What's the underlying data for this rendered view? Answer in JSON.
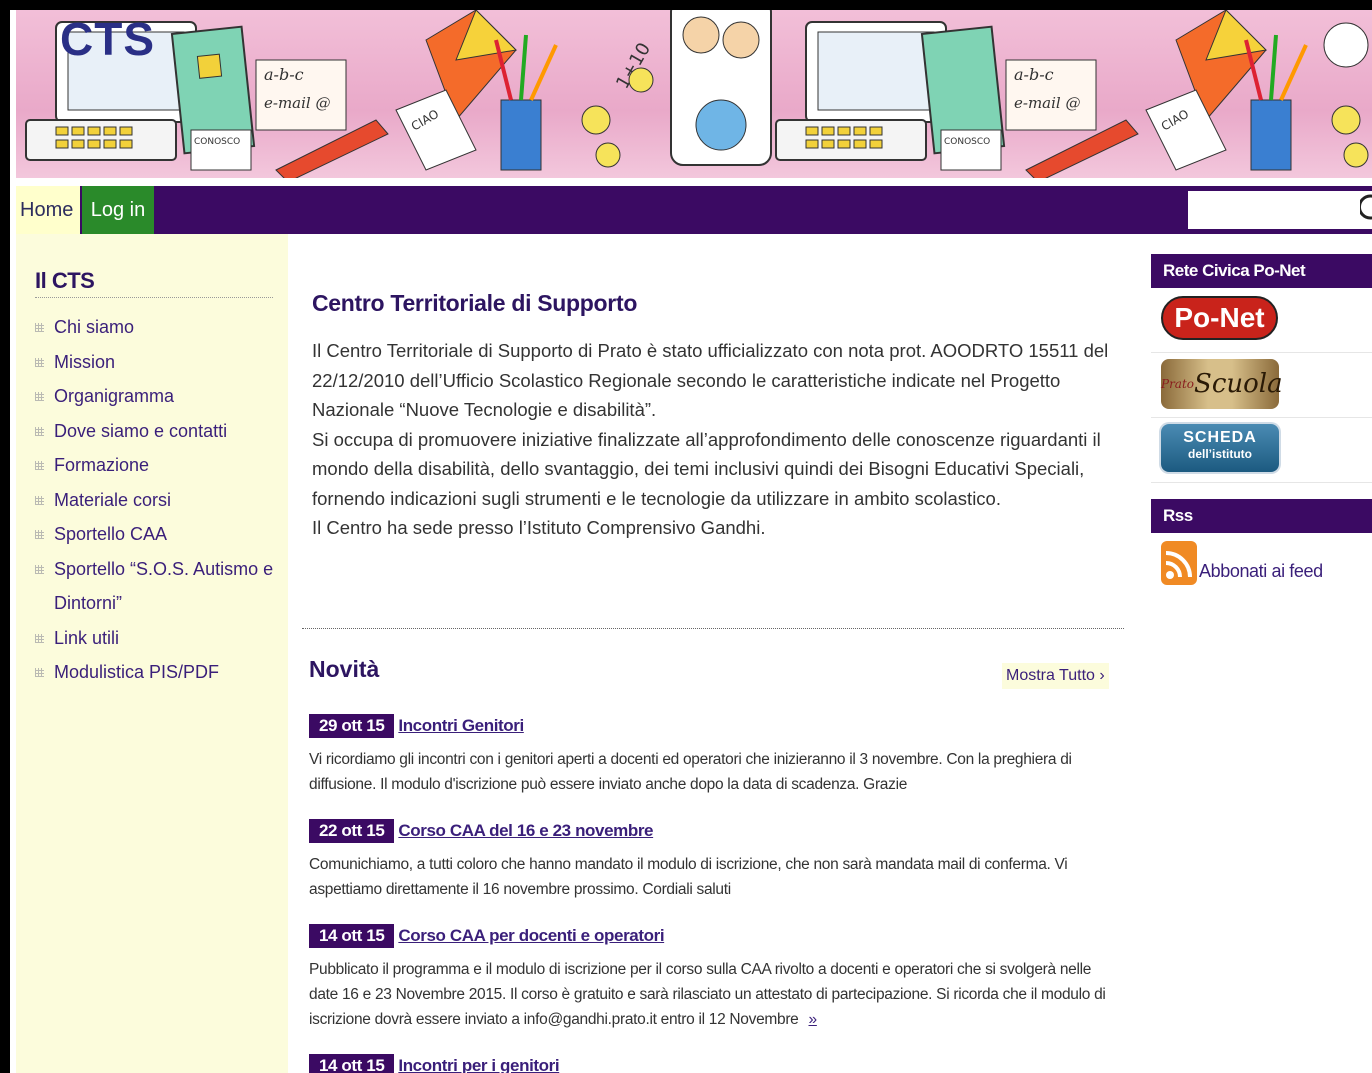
{
  "header": {
    "logo_text": "CTS",
    "banner_words": [
      "a-b-c",
      "e-mail @",
      "CONOSCO",
      "CIAO",
      "1+10"
    ]
  },
  "nav": {
    "home": "Home",
    "login": "Log in",
    "search_placeholder": "",
    "search_icon": "search-icon"
  },
  "sidebar": {
    "title": "Il CTS",
    "items": [
      {
        "label": "Chi siamo"
      },
      {
        "label": "Mission"
      },
      {
        "label": "Organigramma"
      },
      {
        "label": "Dove siamo e contatti"
      },
      {
        "label": "Formazione"
      },
      {
        "label": "Materiale corsi"
      },
      {
        "label": "Sportello CAA"
      },
      {
        "label": "Sportello “S.O.S. Autismo e Dintorni”"
      },
      {
        "label": "Link utili"
      },
      {
        "label": "Modulistica PIS/PDF"
      }
    ]
  },
  "main": {
    "title": "Centro Territoriale di Supporto",
    "paragraphs": [
      "Il Centro Territoriale di Supporto di Prato è stato ufficializzato con nota prot. AOODRTO 15511 del 22/12/2010 dell’Ufficio Scolastico Regionale secondo le caratteristiche indicate nel Progetto Nazionale “Nuove Tecnologie e disabilità”.",
      "Si occupa di promuovere iniziative finalizzate all’approfondimento delle conoscenze riguardanti il mondo della disabilità, dello svantaggio, dei temi inclusivi quindi dei Bisogni Educativi Speciali, fornendo indicazioni sugli strumenti e le tecnologie da utilizzare in ambito scolastico.",
      "Il Centro ha sede presso l’Istituto Comprensivo Gandhi."
    ]
  },
  "news": {
    "title": "Novità",
    "show_all": "Mostra Tutto ›",
    "items": [
      {
        "date": "29 ott 15",
        "title": "Incontri Genitori",
        "text": "Vi ricordiamo gli incontri con i genitori aperti a docenti ed operatori che inizieranno il 3 novembre. Con la preghiera di diffusione. Il modulo d'iscrizione può essere inviato anche dopo la data di scadenza. Grazie"
      },
      {
        "date": "22 ott 15",
        "title": "Corso CAA del 16 e 23 novembre",
        "text": "Comunichiamo, a tutti coloro che hanno mandato il modulo di iscrizione, che non sarà mandata mail di conferma. Vi aspettiamo direttamente il 16 novembre prossimo. Cordiali saluti"
      },
      {
        "date": "14 ott 15",
        "title": "Corso CAA per docenti e operatori",
        "text": "Pubblicato il programma e il modulo di iscrizione per il corso sulla CAA rivolto a docenti e operatori che si svolgerà nelle date 16 e 23 Novembre 2015. Il corso è gratuito e sarà rilasciato un attestato di partecipazione. Si ricorda che il modulo di iscrizione dovrà essere inviato a info@gandhi.prato.it entro il 12 Novembre",
        "more": "»"
      },
      {
        "date": "14 ott 15",
        "title": "Incontri per i genitori",
        "text": ""
      }
    ]
  },
  "right": {
    "network_title": "Rete Civica Po-Net",
    "ponet_logo": "Po-Net",
    "prato_small": "Prato",
    "prato_logo": "Scuola",
    "scheda_line1": "SCHEDA",
    "scheda_line2": "dell’istituto",
    "rss_title": "Rss",
    "rss_link": "Abbonati ai feed"
  },
  "colors": {
    "nav_bg": "#3b0a63",
    "login_bg": "#2a8a2a",
    "sidebar_bg": "#fcfcdc",
    "title_color": "#2d1561"
  }
}
